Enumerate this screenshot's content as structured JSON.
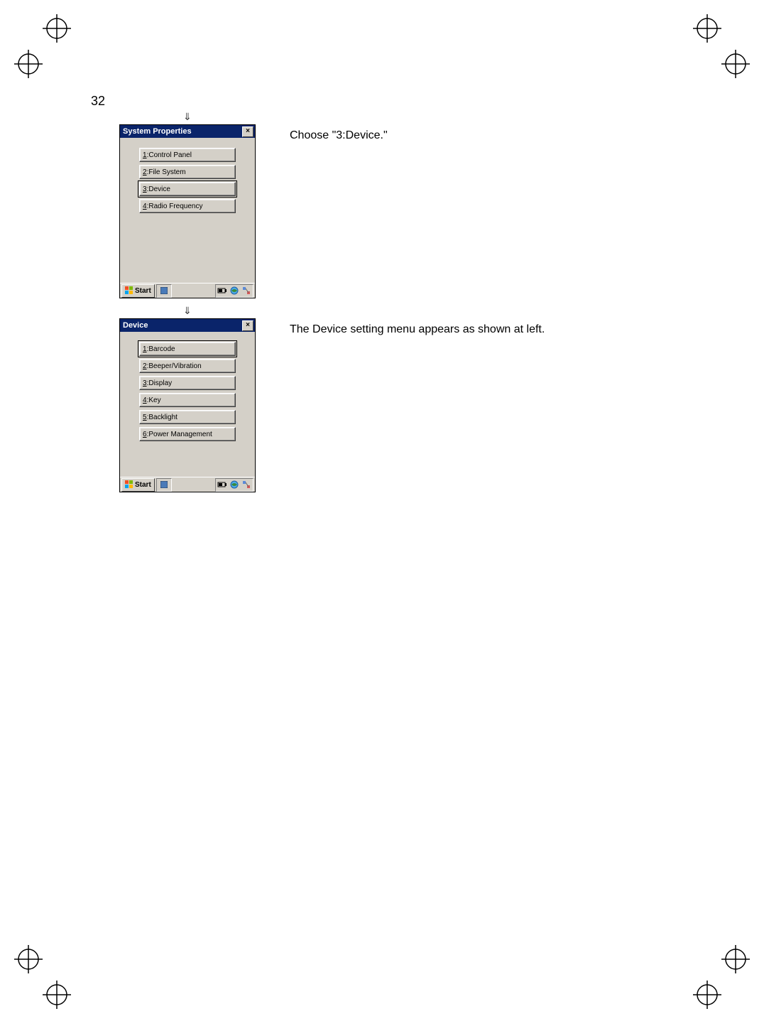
{
  "page_number": "32",
  "arrow_glyph": "⇓",
  "row1": {
    "caption": "Choose \"3:Device.\"",
    "window": {
      "title": "System Properties",
      "close": "×",
      "items": [
        {
          "num": "1",
          "label": ":Control Panel",
          "selected": false
        },
        {
          "num": "2",
          "label": ":File System",
          "selected": false
        },
        {
          "num": "3",
          "label": ":Device",
          "selected": true
        },
        {
          "num": "4",
          "label": ":Radio Frequency",
          "selected": false
        }
      ],
      "start": "Start"
    }
  },
  "row2": {
    "caption": "The Device setting menu appears as shown at left.",
    "window": {
      "title": "Device",
      "close": "×",
      "items": [
        {
          "num": "1",
          "label": ":Barcode",
          "selected": true
        },
        {
          "num": "2",
          "label": ":Beeper/Vibration",
          "selected": false
        },
        {
          "num": "3",
          "label": ":Display",
          "selected": false
        },
        {
          "num": "4",
          "label": ":Key",
          "selected": false
        },
        {
          "num": "5",
          "label": ":Backlight",
          "selected": false
        },
        {
          "num": "6",
          "label": ":Power Management",
          "selected": false
        }
      ],
      "start": "Start"
    }
  }
}
